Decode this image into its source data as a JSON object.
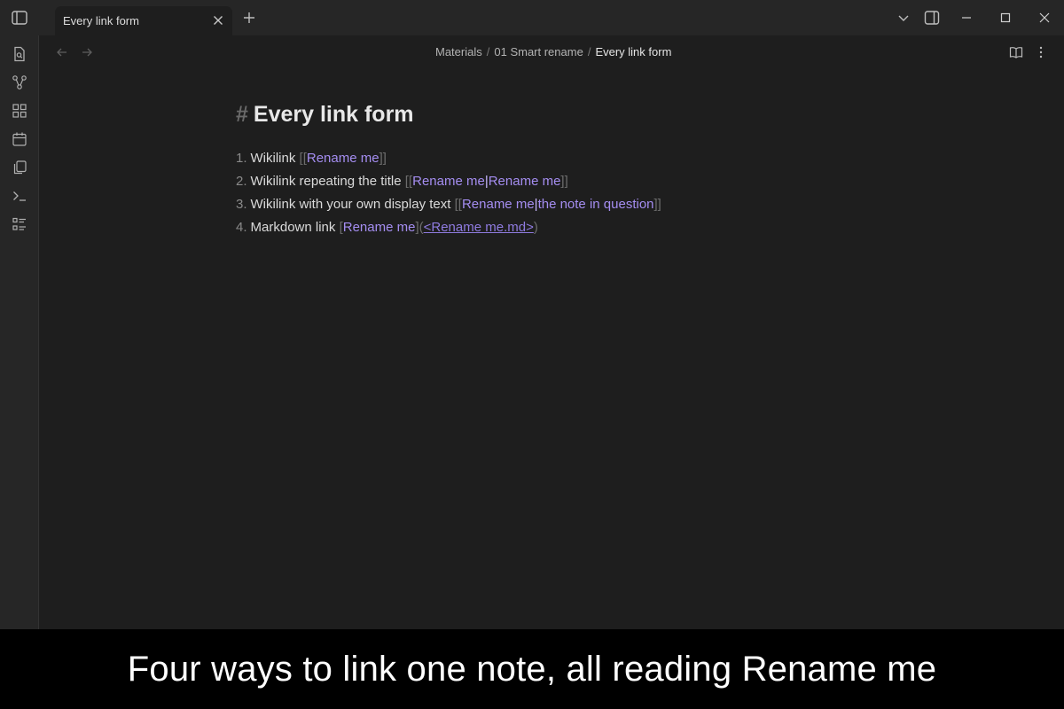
{
  "window": {
    "tab_title": "Every link form"
  },
  "breadcrumb": {
    "items": [
      "Materials",
      "01 Smart rename"
    ],
    "separator": "/",
    "current": "Every link form"
  },
  "note": {
    "heading_marker": "#",
    "heading": "Every link form",
    "items": [
      {
        "num": "1.",
        "label": "Wikilink",
        "open": "[[",
        "target": "Rename me",
        "close": "]]"
      },
      {
        "num": "2.",
        "label": "Wikilink repeating the title",
        "open": "[[",
        "target": "Rename me",
        "pipe": "|",
        "display": "Rename me",
        "close": "]]"
      },
      {
        "num": "3.",
        "label": "Wikilink with your own display text",
        "open": "[[",
        "target": "Rename me",
        "pipe": "|",
        "display": "the note in question",
        "close": "]]"
      },
      {
        "num": "4.",
        "label": "Markdown link",
        "text_open": "[",
        "text": "Rename me",
        "text_close": "]",
        "url_open": "(",
        "url": "<Rename me.md>",
        "url_close": ")"
      }
    ]
  },
  "caption": "Four ways to link one note, all reading Rename me",
  "colors": {
    "accent": "#a48df0",
    "background": "#1e1e1e",
    "chrome": "#262626"
  },
  "icons": {
    "ribbon": [
      "file-search-icon",
      "graph-icon",
      "grid-icon",
      "calendar-icon",
      "copy-icon",
      "terminal-icon",
      "list-icon"
    ]
  }
}
